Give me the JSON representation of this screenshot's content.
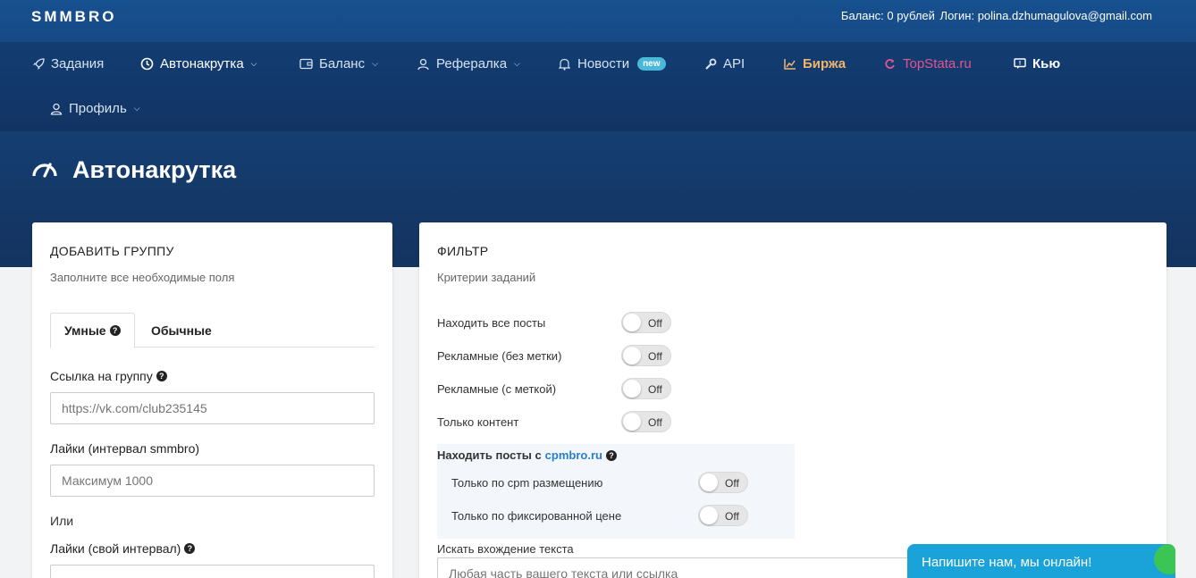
{
  "header": {
    "logo": "SMMBRO",
    "balance_text": "Баланс: 0 рублей",
    "login_text": "Логин: polina.dzhumagulova@gmail.com"
  },
  "nav": {
    "tasks": "Задания",
    "autoboost": "Автонакрутка",
    "balance": "Баланс",
    "referral": "Рефералка",
    "news": "Новости",
    "news_badge": "new",
    "api": "API",
    "exchange": "Биржа",
    "topstata": "TopStata.ru",
    "qu": "Кью",
    "profile": "Профиль",
    "exchange_color": "#f2b46b",
    "topstata_color": "#e3548f"
  },
  "page": {
    "title": "Автонакрутка"
  },
  "add_group": {
    "title": "ДОБАВИТЬ ГРУППУ",
    "subtitle": "Заполните все необходимые поля",
    "tab_smart": "Умные",
    "tab_regular": "Обычные",
    "group_link_label": "Ссылка на группу",
    "group_link_placeholder": "https://vk.com/club235145",
    "likes_smmbro_label": "Лайки (интервал smmbro)",
    "likes_smmbro_placeholder": "Максимум 1000",
    "or": "Или",
    "likes_own_label": "Лайки (свой интервал)"
  },
  "filter": {
    "title": "ФИЛЬТР",
    "subtitle": "Критерии заданий",
    "off": "Off",
    "find_all": "Находить все посты",
    "ads_no_mark": "Рекламные (без метки)",
    "ads_with_mark": "Рекламные (с меткой)",
    "content_only": "Только контент",
    "cpm_prefix": "Находить посты с",
    "cpm_link": "cpmbro.ru",
    "cpm_only": "Только по cpm размещению",
    "fixed_price_only": "Только по фиксированной цене",
    "search_text_label": "Искать вхождение текста",
    "search_text_placeholder": "Любая часть вашего текста или ссылка"
  },
  "chat": {
    "label": "Напишите нам, мы онлайн!"
  }
}
